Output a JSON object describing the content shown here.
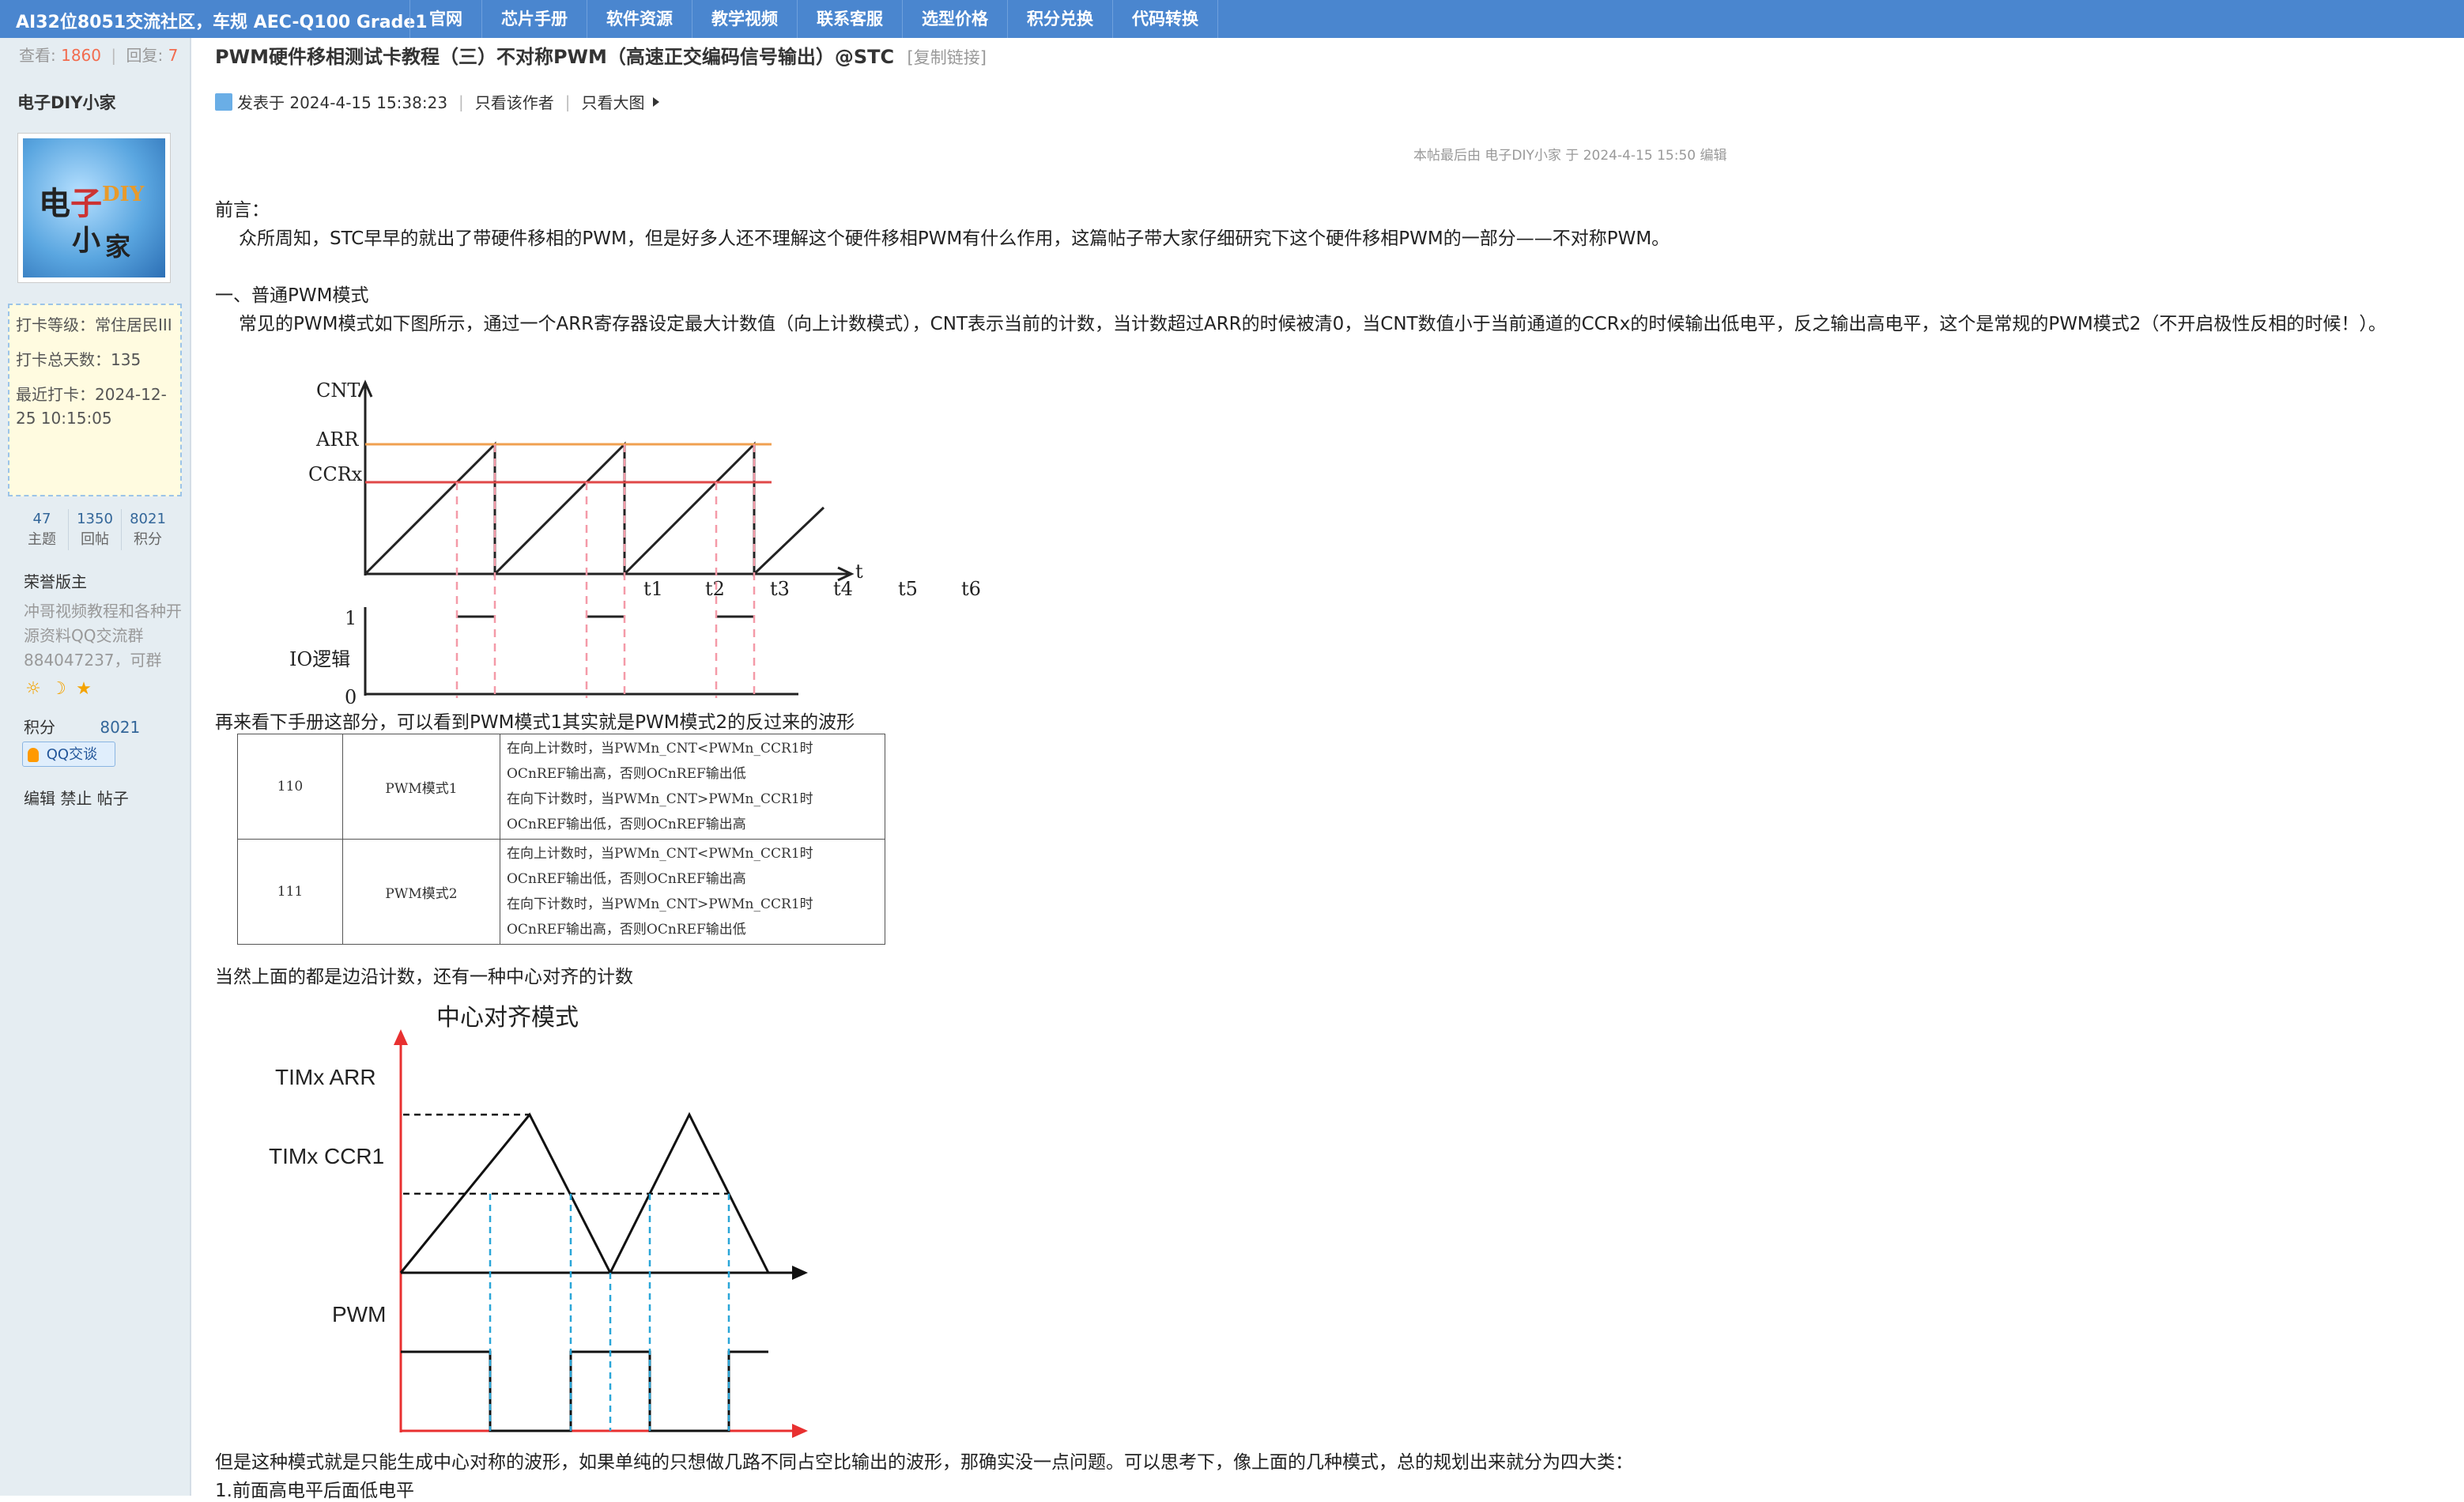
{
  "topbar": {
    "site_title": "AI32位8051交流社区，车规 AEC-Q100 Grade1",
    "nav": [
      "官网",
      "芯片手册",
      "软件资源",
      "教学视频",
      "联系客服",
      "选型价格",
      "积分兑换",
      "代码转换"
    ]
  },
  "sidebar": {
    "views_label": "查看:",
    "views": "1860",
    "replies_label": "回复:",
    "replies": "7",
    "author": "电子DIY小家",
    "avatar_text": [
      "电",
      "子",
      "DIY",
      "小",
      "家"
    ],
    "checkin": {
      "level": "打卡等级：常住居民III",
      "total": "打卡总天数：135",
      "recent": "最近打卡：2024-12-25 10:15:05"
    },
    "counts": [
      {
        "value": "47",
        "label": "主题"
      },
      {
        "value": "1350",
        "label": "回帖"
      },
      {
        "value": "8021",
        "label": "积分"
      }
    ],
    "honor": "荣誉版主",
    "signature": "冲哥视频教程和各种开源资料QQ交流群884047237，可群",
    "points_label": "积分",
    "points_value": "8021",
    "qq_label": "QQ交谈",
    "admin_links": "编辑 禁止 帖子"
  },
  "post": {
    "title": "PWM硬件移相测试卡教程（三）不对称PWM（高速正交编码信号输出）@STC",
    "copy_link": "[复制链接]",
    "posted": "发表于 2024-4-15 15:38:23",
    "only_author": "只看该作者",
    "only_big": "只看大图",
    "edit_note": "本帖最后由 电子DIY小家 于 2024-4-15 15:50 编辑",
    "p1": "前言：",
    "p2": "众所周知，STC早早的就出了带硬件移相的PWM，但是好多人还不理解这个硬件移相PWM有什么作用，这篇帖子带大家仔细研究下这个硬件移相PWM的一部分——不对称PWM。",
    "p3": "一、普通PWM模式",
    "p4": "常见的PWM模式如下图所示，通过一个ARR寄存器设定最大计数值（向上计数模式），CNT表示当前的计数，当计数超过ARR的时候被清0，当CNT数值小于当前通道的CCRx的时候输出低电平，反之输出高电平，这个是常规的PWM模式2（不开启极性反相的时候！）。",
    "p5": "再来看下手册这部分，可以看到PWM模式1其实就是PWM模式2的反过来的波形",
    "p6": "当然上面的都是边沿计数，还有一种中心对齐的计数",
    "p7": "但是这种模式就是只能生成中心对称的波形，如果单纯的只想做几路不同占空比输出的波形，那确实没一点问题。可以思考下，像上面的几种模式，总的规划出来就分为四大类：",
    "p8": "1.前面高电平后面低电平"
  },
  "fig1": {
    "cnt": "CNT",
    "arr": "ARR",
    "ccrx": "CCRx",
    "t": "t",
    "ticks": [
      "t1",
      "t2",
      "t3",
      "t4",
      "t5",
      "t6"
    ],
    "one": "1",
    "io": "IO逻辑",
    "zero": "0"
  },
  "manual_table": {
    "rows": [
      {
        "code": "110",
        "mode": "PWM模式1",
        "lines": [
          "在向上计数时，当PWMn_CNT<PWMn_CCR1时",
          "OCnREF输出高，否则OCnREF输出低",
          "在向下计数时，当PWMn_CNT>PWMn_CCR1时",
          "OCnREF输出低，否则OCnREF输出高"
        ]
      },
      {
        "code": "111",
        "mode": "PWM模式2",
        "lines": [
          "在向上计数时，当PWMn_CNT<PWMn_CCR1时",
          "OCnREF输出低，否则OCnREF输出高",
          "在向下计数时，当PWMn_CNT>PWMn_CCR1时",
          "OCnREF输出高，否则OCnREF输出低"
        ]
      }
    ]
  },
  "fig2": {
    "title": "中心对齐模式",
    "arr": "TIMx ARR",
    "ccr": "TIMx CCR1",
    "pwm": "PWM"
  }
}
